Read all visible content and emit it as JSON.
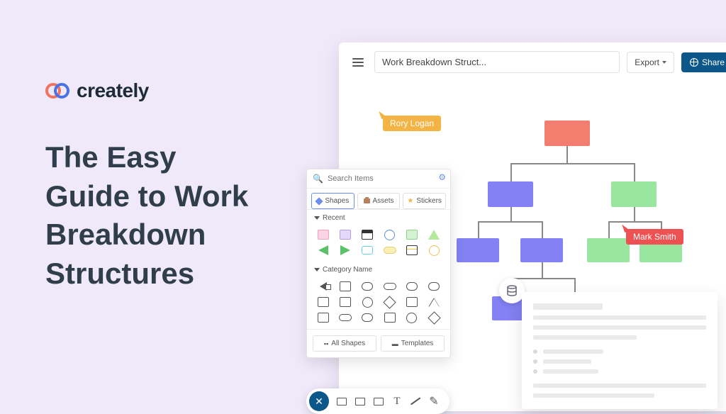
{
  "brand": "creately",
  "title": "The Easy\nGuide to Work\nBreakdown\nStructures",
  "app": {
    "doc_title": "Work Breakdown Struct...",
    "export_label": "Export",
    "share_label": "Share"
  },
  "collaborators": {
    "user1": "Rory Logan",
    "user2": "Mark Smith"
  },
  "panel": {
    "search_placeholder": "Search Items",
    "tabs": {
      "shapes": "Shapes",
      "assets": "Assets",
      "stickers": "Stickers"
    },
    "section_recent": "Recent",
    "section_category": "Category Name",
    "footer_all_shapes": "All Shapes",
    "footer_templates": "Templates"
  }
}
